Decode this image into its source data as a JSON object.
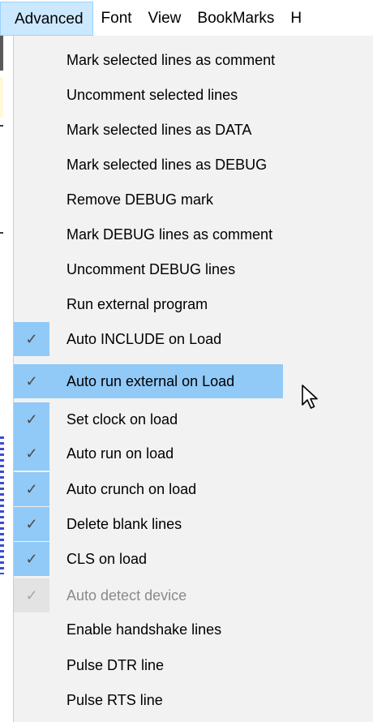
{
  "menubar": {
    "items": [
      {
        "label": "Advanced"
      },
      {
        "label": "Font"
      },
      {
        "label": "View"
      },
      {
        "label": "BookMarks"
      },
      {
        "label": "H"
      }
    ]
  },
  "menu": {
    "items": [
      {
        "label": "Mark selected lines as comment",
        "checked": false
      },
      {
        "label": "Uncomment selected lines",
        "checked": false
      },
      {
        "label": "Mark selected lines as DATA",
        "checked": false
      },
      {
        "label": "Mark selected lines as DEBUG",
        "checked": false
      },
      {
        "label": "Remove DEBUG mark",
        "checked": false
      },
      {
        "label": "Mark DEBUG lines as comment",
        "checked": false
      },
      {
        "label": "Uncomment DEBUG lines",
        "checked": false
      },
      {
        "label": "Run external program",
        "checked": false
      },
      {
        "label": "Auto INCLUDE on Load",
        "checked": true
      },
      {
        "label": "Auto run external on Load",
        "checked": true,
        "highlighted": true
      },
      {
        "label": "Set clock on load",
        "checked": true
      },
      {
        "label": "Auto run on load",
        "checked": true
      },
      {
        "label": "Auto crunch on load",
        "checked": true
      },
      {
        "label": "Delete blank lines",
        "checked": true
      },
      {
        "label": "CLS on load",
        "checked": true
      },
      {
        "label": "Auto detect device",
        "checked": true,
        "disabled": true
      },
      {
        "label": "Enable handshake lines",
        "checked": false
      },
      {
        "label": "Pulse DTR line",
        "checked": false
      },
      {
        "label": "Pulse RTS line",
        "checked": false
      }
    ]
  },
  "icons": {
    "check": "✓",
    "cursor": "arrow-pointer-icon"
  },
  "colors": {
    "highlight": "#91c9f7",
    "menubar_open": "#cce8ff",
    "menu_background": "#f2f2f2",
    "disabled_text": "#8a8a8a"
  }
}
